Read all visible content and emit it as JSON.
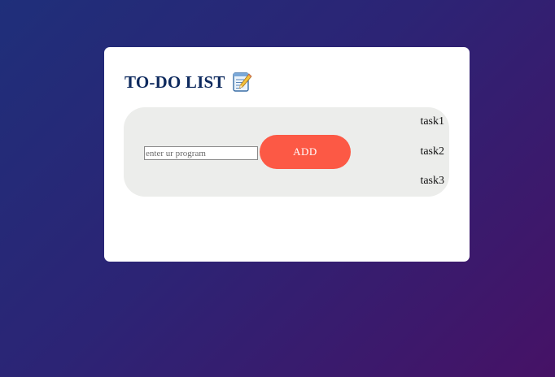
{
  "app": {
    "title": "TO-DO LIST",
    "title_icon": "notepad-pencil-icon"
  },
  "form": {
    "input_placeholder": "enter ur program",
    "input_value": "",
    "add_label": "ADD"
  },
  "tasks": [
    "task1",
    "task2",
    "task3"
  ],
  "colors": {
    "accent": "#fc5945",
    "title": "#0e2a5e",
    "panel": "#ecedeb",
    "card": "#ffffff"
  }
}
